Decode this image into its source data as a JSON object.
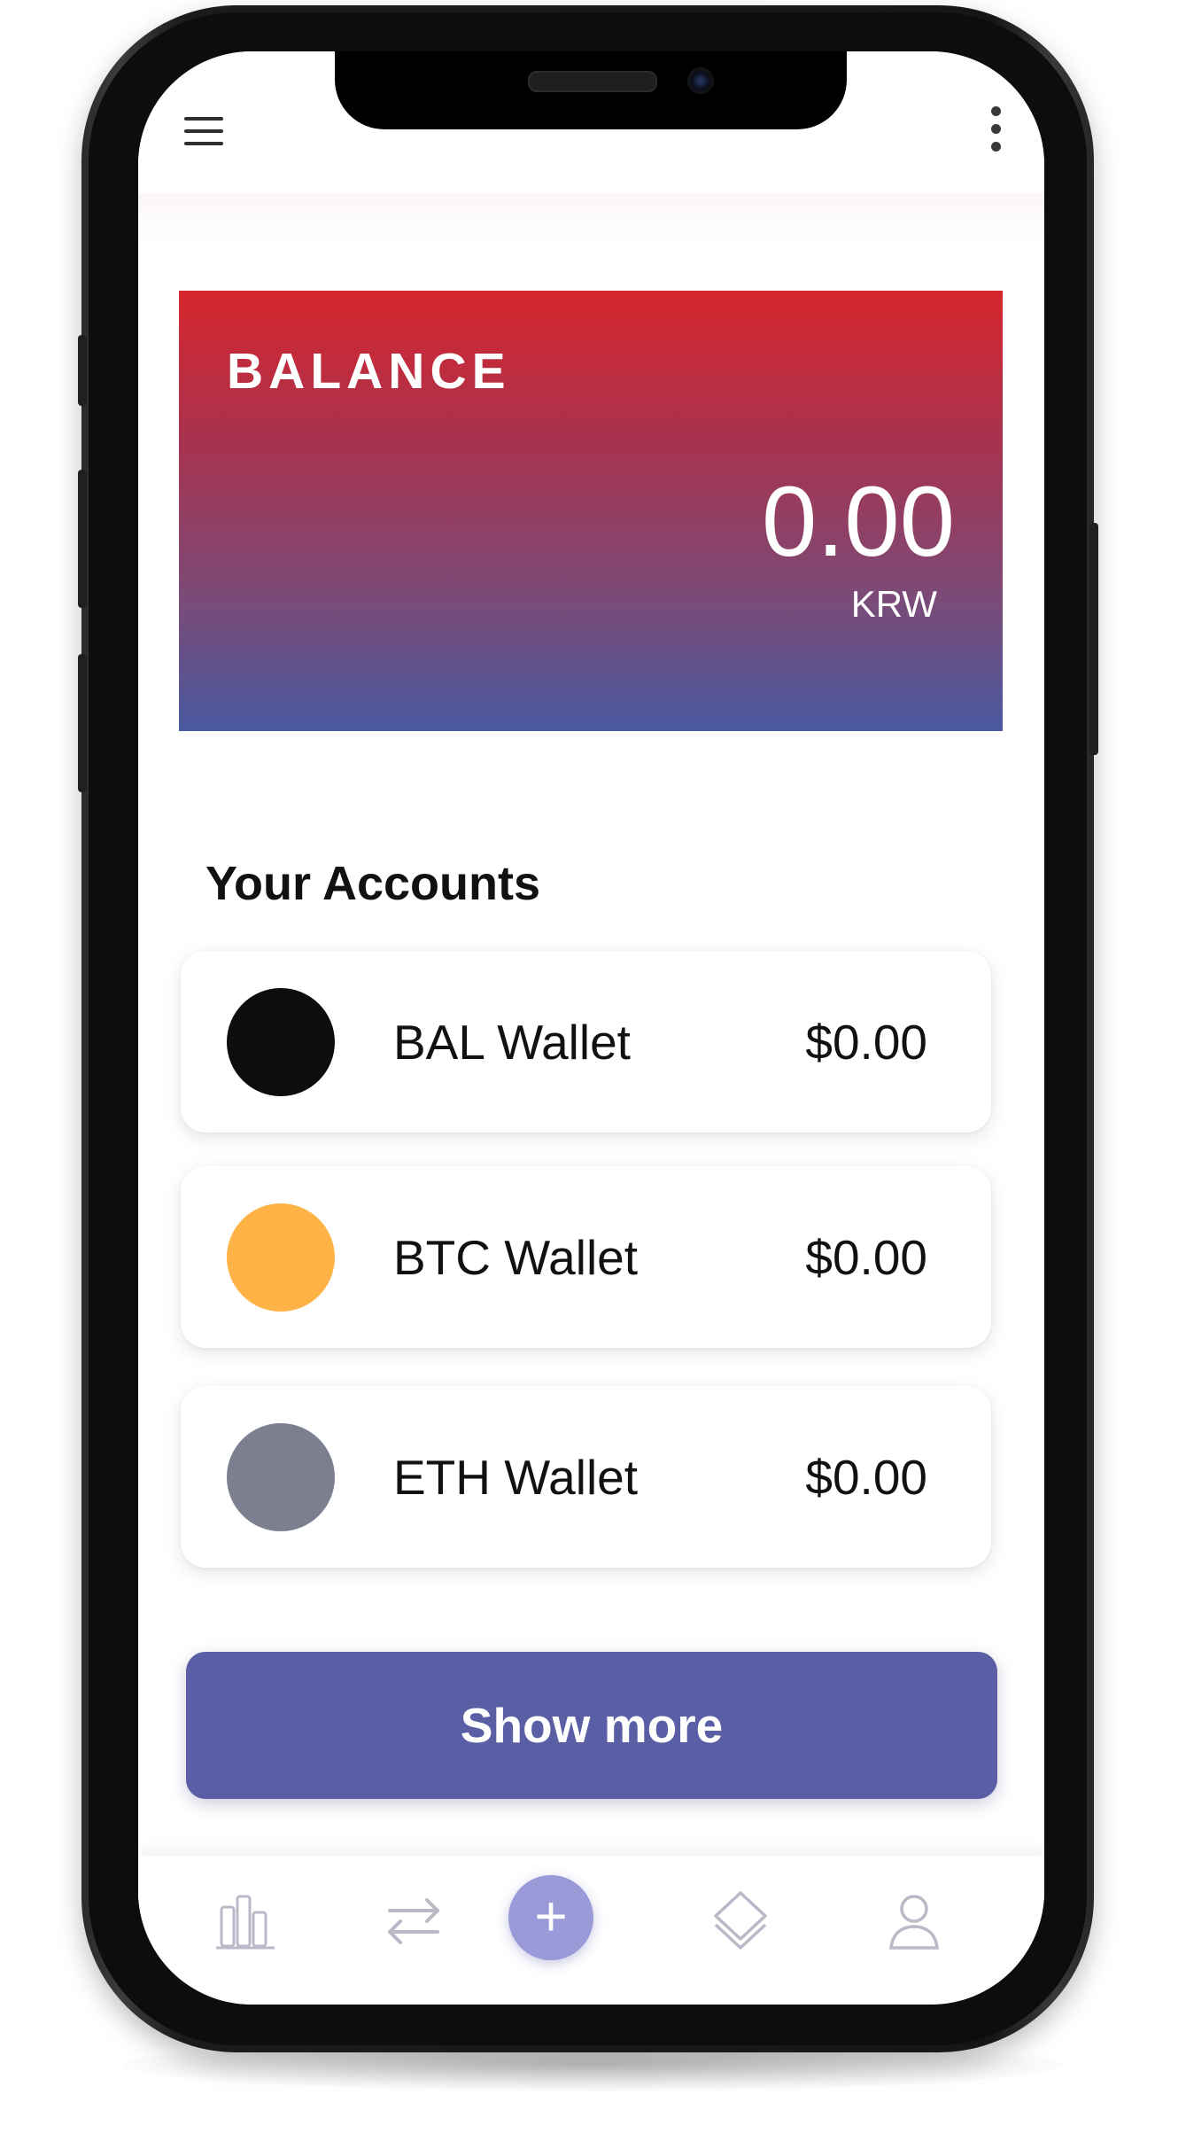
{
  "header": {
    "menu_icon": "hamburger-menu-icon",
    "more_icon": "vertical-dots-icon"
  },
  "balance": {
    "label": "BALANCE",
    "amount": "0.00",
    "currency": "KRW",
    "gradient": [
      "#d6262d",
      "#4a5aa0"
    ]
  },
  "accounts": {
    "title": "Your Accounts",
    "wallets": [
      {
        "name": "BAL Wallet",
        "amount": "$0.00",
        "color": "#0d0d0d"
      },
      {
        "name": "BTC Wallet",
        "amount": "$0.00",
        "color": "#ffb347"
      },
      {
        "name": "ETH Wallet",
        "amount": "$0.00",
        "color": "#7c7f8f"
      }
    ],
    "show_more_label": "Show more",
    "show_more_color": "#5a5fa5"
  },
  "bottom_nav": {
    "items": [
      {
        "icon": "bar-chart-icon"
      },
      {
        "icon": "transfer-arrows-icon"
      },
      {
        "icon": "plus-icon",
        "label": "+"
      },
      {
        "icon": "layers-diamond-icon"
      },
      {
        "icon": "user-profile-icon"
      }
    ]
  }
}
